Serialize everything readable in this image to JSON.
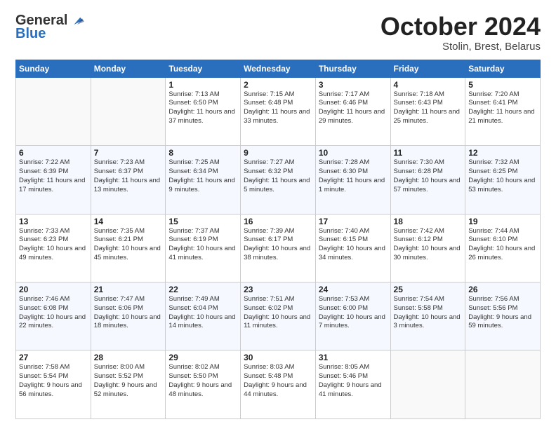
{
  "logo": {
    "general": "General",
    "blue": "Blue"
  },
  "header": {
    "month": "October 2024",
    "location": "Stolin, Brest, Belarus"
  },
  "days_of_week": [
    "Sunday",
    "Monday",
    "Tuesday",
    "Wednesday",
    "Thursday",
    "Friday",
    "Saturday"
  ],
  "weeks": [
    [
      {
        "day": "",
        "info": ""
      },
      {
        "day": "",
        "info": ""
      },
      {
        "day": "1",
        "sunrise": "7:13 AM",
        "sunset": "6:50 PM",
        "daylight": "11 hours and 37 minutes."
      },
      {
        "day": "2",
        "sunrise": "7:15 AM",
        "sunset": "6:48 PM",
        "daylight": "11 hours and 33 minutes."
      },
      {
        "day": "3",
        "sunrise": "7:17 AM",
        "sunset": "6:46 PM",
        "daylight": "11 hours and 29 minutes."
      },
      {
        "day": "4",
        "sunrise": "7:18 AM",
        "sunset": "6:43 PM",
        "daylight": "11 hours and 25 minutes."
      },
      {
        "day": "5",
        "sunrise": "7:20 AM",
        "sunset": "6:41 PM",
        "daylight": "11 hours and 21 minutes."
      }
    ],
    [
      {
        "day": "6",
        "sunrise": "7:22 AM",
        "sunset": "6:39 PM",
        "daylight": "11 hours and 17 minutes."
      },
      {
        "day": "7",
        "sunrise": "7:23 AM",
        "sunset": "6:37 PM",
        "daylight": "11 hours and 13 minutes."
      },
      {
        "day": "8",
        "sunrise": "7:25 AM",
        "sunset": "6:34 PM",
        "daylight": "11 hours and 9 minutes."
      },
      {
        "day": "9",
        "sunrise": "7:27 AM",
        "sunset": "6:32 PM",
        "daylight": "11 hours and 5 minutes."
      },
      {
        "day": "10",
        "sunrise": "7:28 AM",
        "sunset": "6:30 PM",
        "daylight": "11 hours and 1 minute."
      },
      {
        "day": "11",
        "sunrise": "7:30 AM",
        "sunset": "6:28 PM",
        "daylight": "10 hours and 57 minutes."
      },
      {
        "day": "12",
        "sunrise": "7:32 AM",
        "sunset": "6:25 PM",
        "daylight": "10 hours and 53 minutes."
      }
    ],
    [
      {
        "day": "13",
        "sunrise": "7:33 AM",
        "sunset": "6:23 PM",
        "daylight": "10 hours and 49 minutes."
      },
      {
        "day": "14",
        "sunrise": "7:35 AM",
        "sunset": "6:21 PM",
        "daylight": "10 hours and 45 minutes."
      },
      {
        "day": "15",
        "sunrise": "7:37 AM",
        "sunset": "6:19 PM",
        "daylight": "10 hours and 41 minutes."
      },
      {
        "day": "16",
        "sunrise": "7:39 AM",
        "sunset": "6:17 PM",
        "daylight": "10 hours and 38 minutes."
      },
      {
        "day": "17",
        "sunrise": "7:40 AM",
        "sunset": "6:15 PM",
        "daylight": "10 hours and 34 minutes."
      },
      {
        "day": "18",
        "sunrise": "7:42 AM",
        "sunset": "6:12 PM",
        "daylight": "10 hours and 30 minutes."
      },
      {
        "day": "19",
        "sunrise": "7:44 AM",
        "sunset": "6:10 PM",
        "daylight": "10 hours and 26 minutes."
      }
    ],
    [
      {
        "day": "20",
        "sunrise": "7:46 AM",
        "sunset": "6:08 PM",
        "daylight": "10 hours and 22 minutes."
      },
      {
        "day": "21",
        "sunrise": "7:47 AM",
        "sunset": "6:06 PM",
        "daylight": "10 hours and 18 minutes."
      },
      {
        "day": "22",
        "sunrise": "7:49 AM",
        "sunset": "6:04 PM",
        "daylight": "10 hours and 14 minutes."
      },
      {
        "day": "23",
        "sunrise": "7:51 AM",
        "sunset": "6:02 PM",
        "daylight": "10 hours and 11 minutes."
      },
      {
        "day": "24",
        "sunrise": "7:53 AM",
        "sunset": "6:00 PM",
        "daylight": "10 hours and 7 minutes."
      },
      {
        "day": "25",
        "sunrise": "7:54 AM",
        "sunset": "5:58 PM",
        "daylight": "10 hours and 3 minutes."
      },
      {
        "day": "26",
        "sunrise": "7:56 AM",
        "sunset": "5:56 PM",
        "daylight": "9 hours and 59 minutes."
      }
    ],
    [
      {
        "day": "27",
        "sunrise": "7:58 AM",
        "sunset": "5:54 PM",
        "daylight": "9 hours and 56 minutes."
      },
      {
        "day": "28",
        "sunrise": "8:00 AM",
        "sunset": "5:52 PM",
        "daylight": "9 hours and 52 minutes."
      },
      {
        "day": "29",
        "sunrise": "8:02 AM",
        "sunset": "5:50 PM",
        "daylight": "9 hours and 48 minutes."
      },
      {
        "day": "30",
        "sunrise": "8:03 AM",
        "sunset": "5:48 PM",
        "daylight": "9 hours and 44 minutes."
      },
      {
        "day": "31",
        "sunrise": "8:05 AM",
        "sunset": "5:46 PM",
        "daylight": "9 hours and 41 minutes."
      },
      {
        "day": "",
        "info": ""
      },
      {
        "day": "",
        "info": ""
      }
    ]
  ]
}
